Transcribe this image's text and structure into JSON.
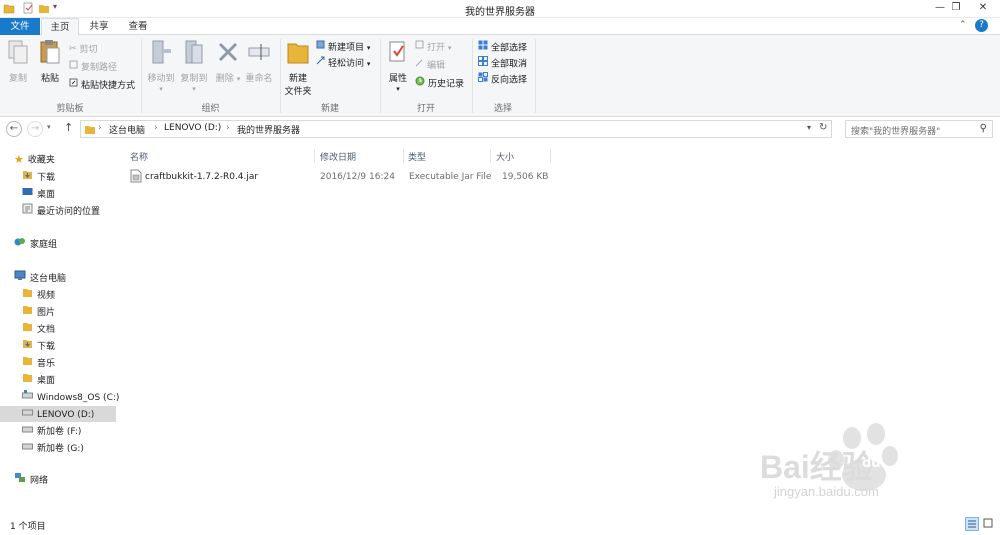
{
  "window": {
    "title": "我的世界服务器",
    "controls": [
      "minimize",
      "restore",
      "close"
    ]
  },
  "tabs": {
    "file": "文件",
    "home": "主页",
    "share": "共享",
    "view": "查看"
  },
  "ribbon": {
    "clipboard": {
      "copy": "复制",
      "paste": "粘贴",
      "cut": "剪切",
      "copy_path": "复制路径",
      "paste_shortcut": "粘贴快捷方式",
      "label": "剪贴板"
    },
    "organize": {
      "move_to": "移动到",
      "copy_to": "复制到",
      "delete": "删除",
      "rename": "重命名",
      "label": "组织"
    },
    "new": {
      "new_folder_line1": "新建",
      "new_folder_line2": "文件夹",
      "new_item": "新建项目",
      "easy_access": "轻松访问",
      "label": "新建"
    },
    "open": {
      "properties": "属性",
      "open": "打开",
      "edit": "编辑",
      "history": "历史记录",
      "label": "打开"
    },
    "select": {
      "select_all": "全部选择",
      "select_none": "全部取消",
      "invert": "反向选择",
      "label": "选择"
    }
  },
  "address": {
    "crumbs": [
      "这台电脑",
      "LENOVO (D:)",
      "我的世界服务器"
    ],
    "search_placeholder": "搜索\"我的世界服务器\""
  },
  "sidebar": {
    "favorites": "收藏夹",
    "fav_items": [
      "下载",
      "桌面",
      "最近访问的位置"
    ],
    "homegroup": "家庭组",
    "this_pc": "这台电脑",
    "pc_items": [
      "视频",
      "图片",
      "文档",
      "下载",
      "音乐",
      "桌面",
      "Windows8_OS (C:)",
      "LENOVO (D:)",
      "新加卷 (F:)",
      "新加卷 (G:)"
    ],
    "network": "网络"
  },
  "columns": {
    "name": "名称",
    "modified": "修改日期",
    "type": "类型",
    "size": "大小"
  },
  "files": [
    {
      "name": "craftbukkit-1.7.2-R0.4.jar",
      "modified": "2016/12/9 16:24",
      "type": "Executable Jar File",
      "size": "19,506 KB"
    }
  ],
  "status": {
    "count": "1 个项目"
  },
  "watermark": {
    "brand": "Bai经验",
    "brand_du": "du",
    "url": "jingyan.baidu.com"
  },
  "colors": {
    "accent": "#1979ca",
    "folder": "#e8b43a",
    "header_text": "#4c607a"
  }
}
